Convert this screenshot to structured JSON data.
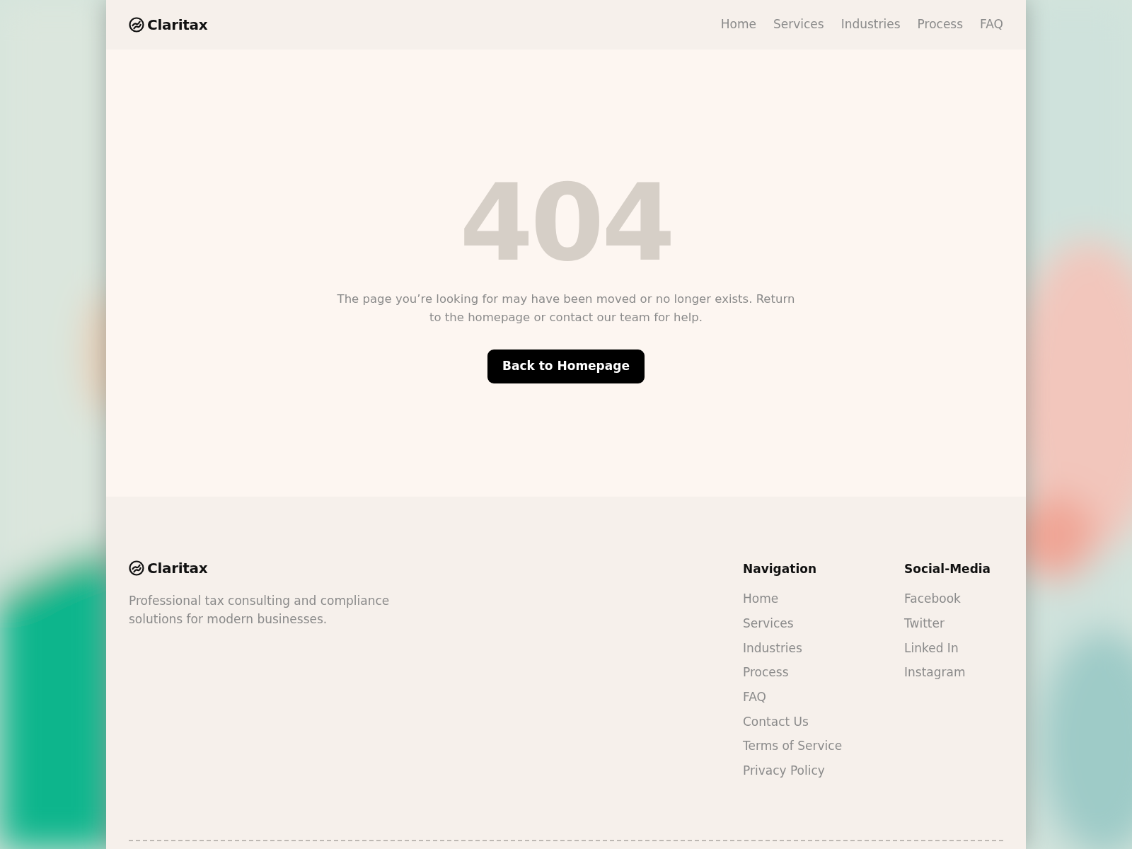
{
  "header": {
    "logo": "Claritax",
    "nav": [
      "Home",
      "Services",
      "Industries",
      "Process",
      "FAQ"
    ]
  },
  "error": {
    "code": "404",
    "message": "The page you’re looking for may have been moved or no longer exists. Return to the homepage or contact our team for help.",
    "button": "Back to Homepage"
  },
  "footer": {
    "logo": "Claritax",
    "tagline": "Professional tax consulting and compliance solutions for modern businesses.",
    "columns": [
      {
        "title": "Navigation",
        "links": [
          "Home",
          "Services",
          "Industries",
          "Process",
          "FAQ",
          "Contact Us",
          "Terms of Service",
          "Privacy Policy"
        ]
      },
      {
        "title": "Social-Media",
        "links": [
          "Facebook",
          "Twitter",
          "Linked In",
          "Instagram"
        ]
      }
    ]
  }
}
